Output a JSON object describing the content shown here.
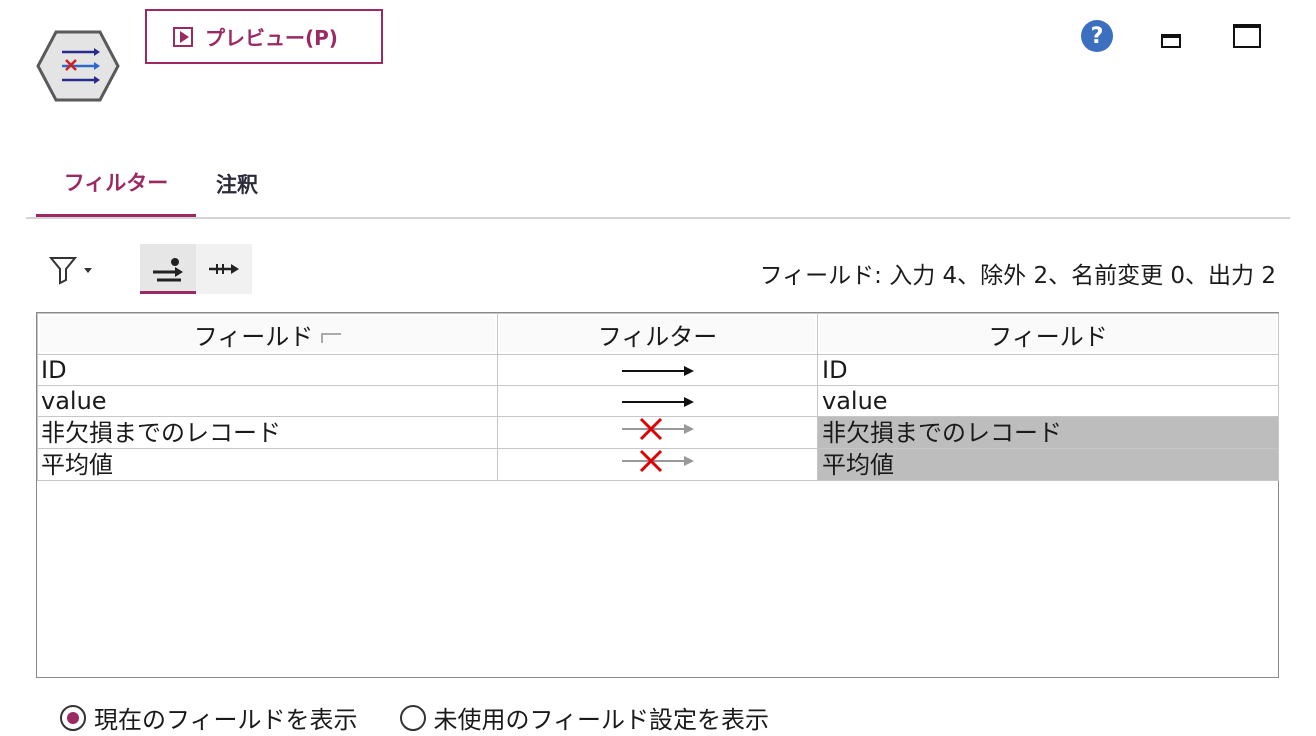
{
  "header": {
    "preview_label": "プレビュー(P)",
    "help_glyph": "?"
  },
  "tabs": [
    {
      "label": "フィルター",
      "active": true
    },
    {
      "label": "注釈",
      "active": false
    }
  ],
  "toolbar": {
    "field_summary": "フィールド: 入力 4、除外 2、名前変更 0、出力 2"
  },
  "table": {
    "columns": [
      "フィールド",
      "フィルター",
      "フィールド"
    ],
    "rows": [
      {
        "input": "ID",
        "filter": "pass",
        "output": "ID",
        "excluded": false
      },
      {
        "input": "value",
        "filter": "pass",
        "output": "value",
        "excluded": false
      },
      {
        "input": "非欠損までのレコード",
        "filter": "exclude",
        "output": "非欠損までのレコード",
        "excluded": true
      },
      {
        "input": "平均値",
        "filter": "exclude",
        "output": "平均値",
        "excluded": true
      }
    ]
  },
  "options": [
    {
      "label": "現在のフィールドを表示",
      "selected": true
    },
    {
      "label": "未使用のフィールド設定を表示",
      "selected": false
    }
  ],
  "colors": {
    "accent": "#9c2a62",
    "excluded_bg": "#bdbdbd",
    "help_blue": "#3c6fbf"
  },
  "icons": {
    "node": "filter-node-icon",
    "funnel": "funnel-icon",
    "pass_arrow": "pass-arrow-icon",
    "exclude_arrow": "exclude-arrow-icon"
  }
}
